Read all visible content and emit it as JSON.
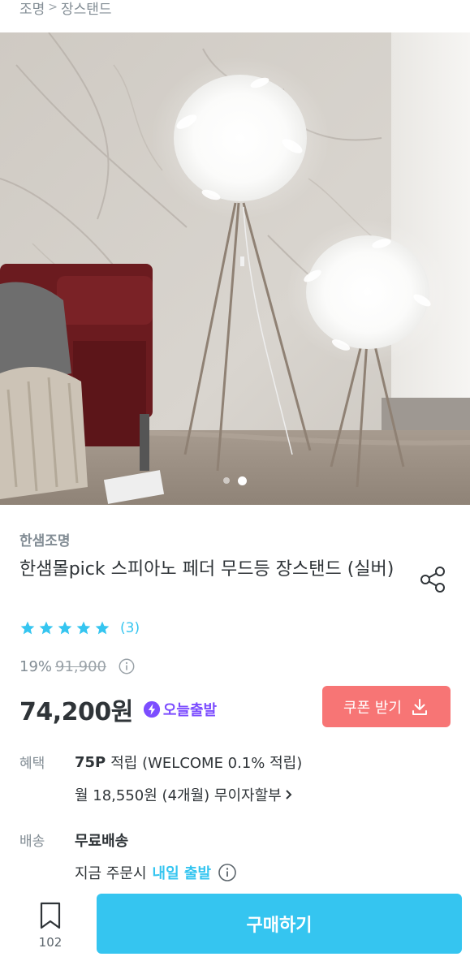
{
  "breadcrumb": {
    "items": [
      "조명",
      "장스탠드"
    ],
    "separator": ">"
  },
  "hero": {
    "image_alt": "feather floor lamps",
    "slide_count": 2,
    "active_slide": 2
  },
  "product": {
    "brand": "한샘조명",
    "title": "한샘몰pick 스피아노 페더 무드등 장스탠드 (실버)",
    "rating_stars": 5,
    "review_count": "(3)",
    "discount": "19%",
    "original_price": "91,900",
    "price": "74,200원",
    "badge": "오늘출발"
  },
  "coupon": {
    "label": "쿠폰 받기"
  },
  "benefits": {
    "label": "혜택",
    "points": "75P",
    "points_text": "적립 (WELCOME 0.1% 적립)",
    "installment": "월 18,550원 (4개월) 무이자할부"
  },
  "shipping": {
    "label": "배송",
    "free": "무료배송",
    "order_prefix": "지금 주문시",
    "ship_highlight": "내일 출발"
  },
  "bottom": {
    "bookmark_count": "102",
    "buy_label": "구매하기"
  },
  "colors": {
    "accent": "#35c5f0",
    "coupon": "#f77575",
    "today": "#7c4dff",
    "text": "#2f3438",
    "muted": "#828c94"
  }
}
